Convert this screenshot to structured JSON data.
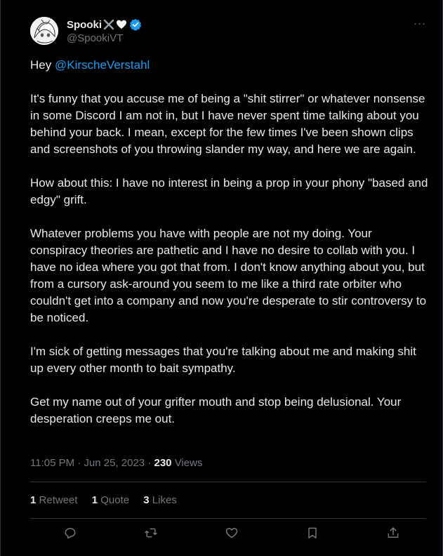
{
  "author": {
    "display_name": "Spooki",
    "handle": "@SpookiVT",
    "avatar_icon": "anime-avatar",
    "name_emojis": [
      "crossed-swords-icon",
      "white-heart-icon"
    ],
    "verified_color": "#1d9bf0"
  },
  "post": {
    "greeting": "Hey ",
    "mention": "@KirscheVerstahl",
    "paragraphs": [
      "It's funny that you accuse me of being a \"shit stirrer\" or whatever nonsense in some Discord I am not in, but I have never spent time talking about you behind your back. I mean, except for the few times I've been shown clips and screenshots of you throwing slander my way, and here we are again.",
      "How about this: I have no interest in being a prop in your phony \"based and edgy\" grift.",
      "Whatever problems you have with people are not my doing. Your conspiracy theories are pathetic and I have no desire to collab with you. I have no idea where you got that from. I don't know anything about you, but from a cursory ask-around you seem to me like a third rate orbiter who couldn't get into a company and now you're desperate to stir controversy to be noticed.",
      "I'm sick of getting messages that you're talking about me and making shit up every other month to bait sympathy.",
      "Get my name out of your grifter mouth and stop being delusional. Your desperation creeps me out."
    ]
  },
  "meta": {
    "time": "11:05 PM · Jun 25, 2023 · ",
    "views_count": "230",
    "views_label": " Views"
  },
  "stats": {
    "retweets_count": "1",
    "retweets_label": "Retweet",
    "quotes_count": "1",
    "quotes_label": "Quote",
    "likes_count": "3",
    "likes_label": "Likes"
  },
  "actions": [
    "reply-icon",
    "retweet-icon",
    "like-icon",
    "bookmark-icon",
    "share-icon"
  ],
  "colors": {
    "background": "#000000",
    "text": "#e7e9ea",
    "secondary": "#71767b",
    "link": "#1d9bf0",
    "divider": "#2f3336"
  }
}
